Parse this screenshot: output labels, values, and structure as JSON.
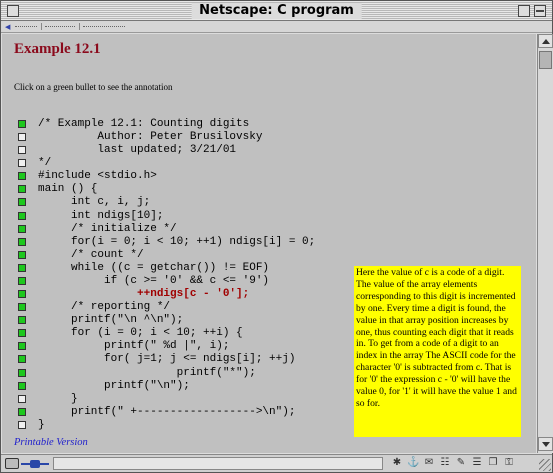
{
  "window": {
    "title": "Netscape: C program"
  },
  "page": {
    "title": "Example 12.1",
    "instruction": "Click on a green bullet to see the annotation",
    "printable_link": "Printable Version"
  },
  "code_lines": [
    {
      "text": "/* Example 12.1: Counting digits",
      "bullet": "green"
    },
    {
      "text": "         Author: Peter Brusilovsky",
      "bullet": "white"
    },
    {
      "text": "         last updated; 3/21/01",
      "bullet": "white"
    },
    {
      "text": "*/",
      "bullet": "white"
    },
    {
      "text": "#include <stdio.h>",
      "bullet": "green"
    },
    {
      "text": "main () {",
      "bullet": "green"
    },
    {
      "text": "     int c, i, j;",
      "bullet": "green"
    },
    {
      "text": "     int ndigs[10];",
      "bullet": "green"
    },
    {
      "text": "     /* initialize */",
      "bullet": "green"
    },
    {
      "text": "     for(i = 0; i < 10; ++1) ndigs[i] = 0;",
      "bullet": "green"
    },
    {
      "text": "     /* count */",
      "bullet": "green"
    },
    {
      "text": "     while ((c = getchar()) != EOF)",
      "bullet": "green"
    },
    {
      "text": "          if (c >= '0' && c <= '9')",
      "bullet": "green"
    },
    {
      "text": "               ++ndigs[c - '0'];",
      "bullet": "green",
      "highlight": true
    },
    {
      "text": "     /* reporting */",
      "bullet": "green"
    },
    {
      "text": "     printf(\"\\n ^\\n\");",
      "bullet": "green"
    },
    {
      "text": "     for (i = 0; i < 10; ++i) {",
      "bullet": "green"
    },
    {
      "text": "          printf(\" %d |\", i);",
      "bullet": "green"
    },
    {
      "text": "          for( j=1; j <= ndigs[i]; ++j)",
      "bullet": "green"
    },
    {
      "text": "                     printf(\"*\");",
      "bullet": "green"
    },
    {
      "text": "          printf(\"\\n\");",
      "bullet": "green"
    },
    {
      "text": "     }",
      "bullet": "white"
    },
    {
      "text": "     printf(\" +------------------>\\n\");",
      "bullet": "green"
    },
    {
      "text": "}",
      "bullet": "white"
    }
  ],
  "annotation": {
    "text": "Here the value of c is a code of a digit. The value of the array elements corresponding to this digit is incremented by one. Every time a digit is found, the value in that array position increases by one, thus counting each digit that it reads in. To get from a code of a digit to an index in the array The ASCII code for the character '0' is subtracted from c. That is for '0' the expression c - '0' will have the value 0, for '1' it will have the value 1 and so for."
  },
  "colors": {
    "title": "#8b0a1c",
    "bullet_active": "#1ec81e",
    "annotation_bg": "#ffff00",
    "link": "#2222cc",
    "highlight": "#a00000"
  },
  "icons": [
    "close-box",
    "zoom-box",
    "collapse-box",
    "lock-icon",
    "connection-icon",
    "navigator-icon",
    "mail-icon",
    "composer-icon",
    "bookmarks-icon",
    "resize-grip"
  ]
}
